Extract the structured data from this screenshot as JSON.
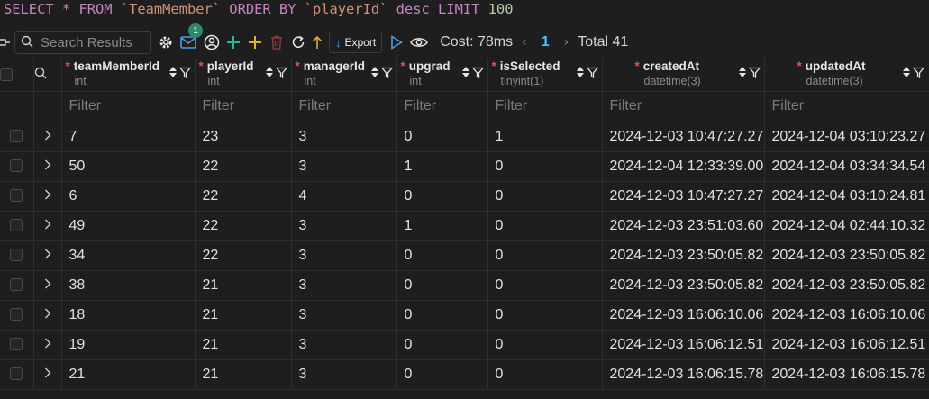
{
  "query": {
    "select": "SELECT",
    "star": "*",
    "from": "FROM",
    "table": "`TeamMember`",
    "order_by": "ORDER BY",
    "column": "`playerId`",
    "desc": "desc",
    "limit": "LIMIT",
    "limit_value": "100"
  },
  "toolbar": {
    "search_placeholder": "Search Results",
    "notification_count": "1",
    "export_label": "Export",
    "cost": "Cost: 78ms",
    "page": "1",
    "total": "Total 41"
  },
  "columns": [
    {
      "name": "teamMemberId",
      "type": "int",
      "required": true
    },
    {
      "name": "playerId",
      "type": "int",
      "required": true
    },
    {
      "name": "managerId",
      "type": "int",
      "required": true
    },
    {
      "name": "upgrad",
      "type": "int",
      "required": true
    },
    {
      "name": "isSelected",
      "type": "tinyint(1)",
      "required": true
    },
    {
      "name": "createdAt",
      "type": "datetime(3)",
      "required": true
    },
    {
      "name": "updatedAt",
      "type": "datetime(3)",
      "required": true
    }
  ],
  "filter_placeholder": "Filter",
  "rows": [
    [
      "7",
      "23",
      "3",
      "0",
      "1",
      "2024-12-03 10:47:27.27",
      "2024-12-04 03:10:23.27"
    ],
    [
      "50",
      "22",
      "3",
      "1",
      "0",
      "2024-12-04 12:33:39.00",
      "2024-12-04 03:34:34.54"
    ],
    [
      "6",
      "22",
      "4",
      "0",
      "0",
      "2024-12-03 10:47:27.27",
      "2024-12-04 03:10:24.81"
    ],
    [
      "49",
      "22",
      "3",
      "1",
      "0",
      "2024-12-03 23:51:03.60",
      "2024-12-04 02:44:10.32"
    ],
    [
      "34",
      "22",
      "3",
      "0",
      "0",
      "2024-12-03 23:50:05.82",
      "2024-12-03 23:50:05.82"
    ],
    [
      "38",
      "21",
      "3",
      "0",
      "0",
      "2024-12-03 23:50:05.82",
      "2024-12-03 23:50:05.82"
    ],
    [
      "18",
      "21",
      "3",
      "0",
      "0",
      "2024-12-03 16:06:10.06",
      "2024-12-03 16:06:10.06"
    ],
    [
      "19",
      "21",
      "3",
      "0",
      "0",
      "2024-12-03 16:06:12.51",
      "2024-12-03 16:06:12.51"
    ],
    [
      "21",
      "21",
      "3",
      "0",
      "0",
      "2024-12-03 16:06:15.78",
      "2024-12-03 16:06:15.78"
    ]
  ],
  "colors": {
    "background": "#1e1e1e",
    "keyword": "#c586c0",
    "string": "#ce9178",
    "number": "#b5cea8",
    "accent": "#4fc1ff",
    "required_marker": "#f14c4c"
  }
}
